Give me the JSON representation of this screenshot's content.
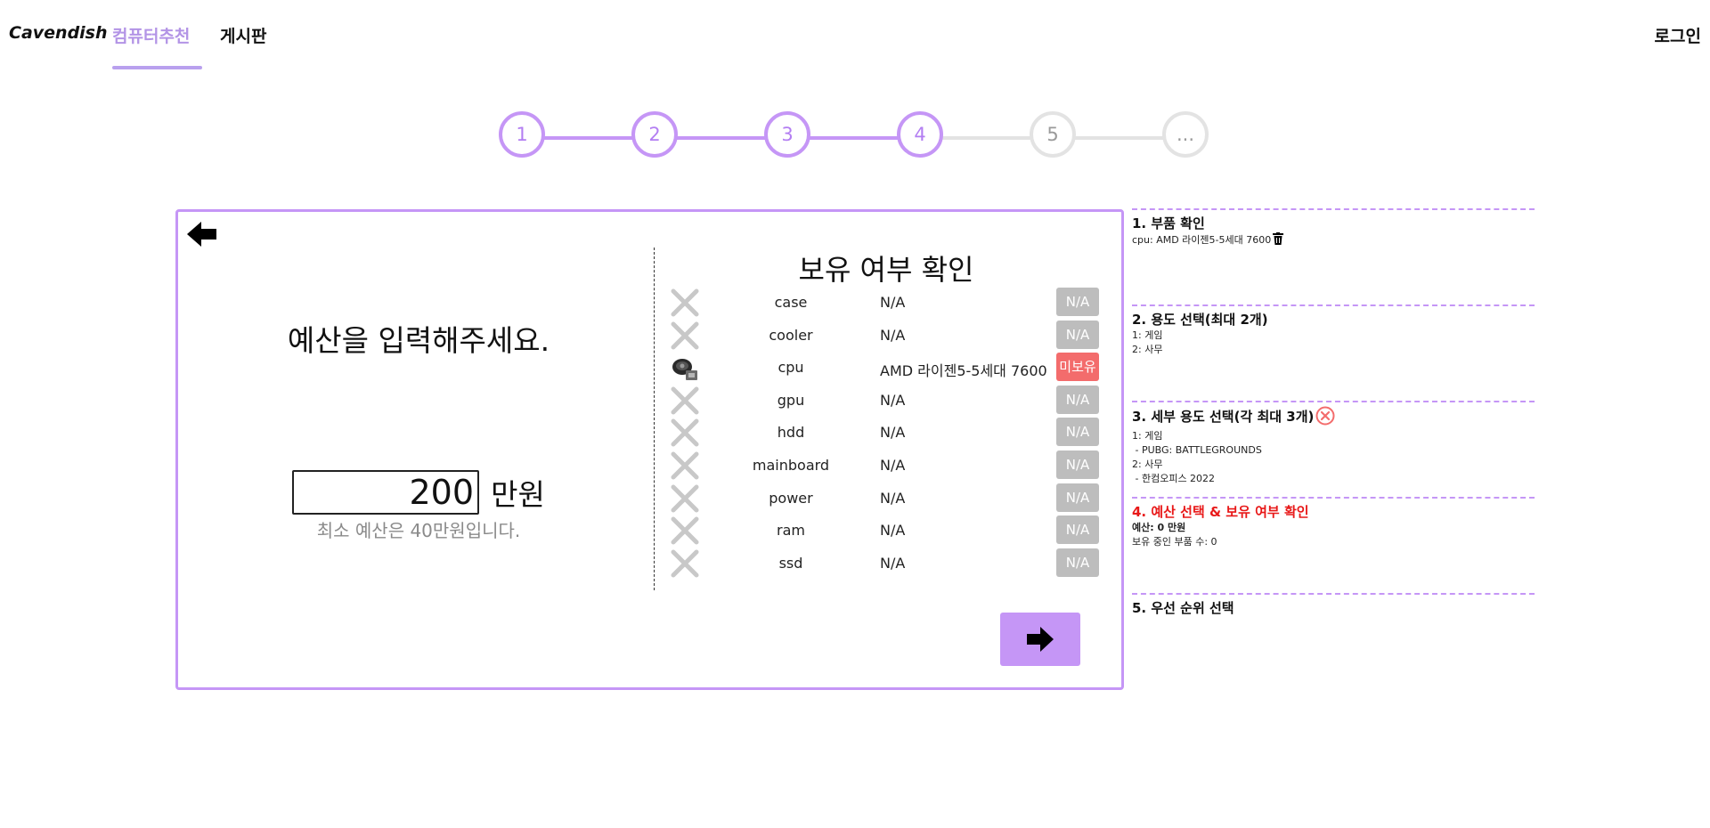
{
  "nav": {
    "brand": "Cavendish",
    "tabs": [
      "컴퓨터추천",
      "게시판"
    ],
    "active_tab": "컴퓨터추천",
    "login": "로그인"
  },
  "stepper": {
    "steps": [
      "1",
      "2",
      "3",
      "4",
      "5",
      "..."
    ],
    "completed_through": 4,
    "active_color": "#c596f6",
    "inactive_color": "#e3e3e3"
  },
  "budget": {
    "title": "예산을 입력해주세요.",
    "value": "200",
    "unit": "만원",
    "min_note": "최소 예산은 40만원입니다."
  },
  "ownership": {
    "title": "보유 여부 확인",
    "parts": [
      {
        "name": "case",
        "model": "N/A",
        "status": "N/A",
        "icon": "x-icon"
      },
      {
        "name": "cooler",
        "model": "N/A",
        "status": "N/A",
        "icon": "x-icon"
      },
      {
        "name": "cpu",
        "model": "AMD 라이젠5-5세대 7600",
        "status": "미보유",
        "icon": "cpu-cooler-icon"
      },
      {
        "name": "gpu",
        "model": "N/A",
        "status": "N/A",
        "icon": "x-icon"
      },
      {
        "name": "hdd",
        "model": "N/A",
        "status": "N/A",
        "icon": "x-icon"
      },
      {
        "name": "mainboard",
        "model": "N/A",
        "status": "N/A",
        "icon": "x-icon"
      },
      {
        "name": "power",
        "model": "N/A",
        "status": "N/A",
        "icon": "x-icon"
      },
      {
        "name": "ram",
        "model": "N/A",
        "status": "N/A",
        "icon": "x-icon"
      },
      {
        "name": "ssd",
        "model": "N/A",
        "status": "N/A",
        "icon": "x-icon"
      }
    ]
  },
  "summary": {
    "sections": [
      {
        "title": "1. 부품 확인",
        "lines": [
          "cpu: AMD 라이젠5-5세대 7600"
        ]
      },
      {
        "title": "2. 용도 선택(최대 2개)",
        "lines": [
          "1: 게임",
          "2: 사무"
        ]
      },
      {
        "title": "3. 세부 용도 선택(각 최대 3개)",
        "lines": [
          "1: 게임",
          " - PUBG: BATTLEGROUNDS",
          "2: 사무",
          " - 한컴오피스 2022"
        ]
      },
      {
        "title": "4. 예산 선택 & 보유 여부 확인",
        "lines": [
          "예산: 0 만원",
          "보유 중인 부품 수: 0"
        ]
      },
      {
        "title": "5. 우선 순위 선택",
        "lines": []
      }
    ]
  },
  "colors": {
    "accent": "#c596f6",
    "nav_active": "#b394e6",
    "missing_badge": "#f36c6c",
    "na_badge": "#bdbdbd",
    "active_section": "#e81818"
  }
}
